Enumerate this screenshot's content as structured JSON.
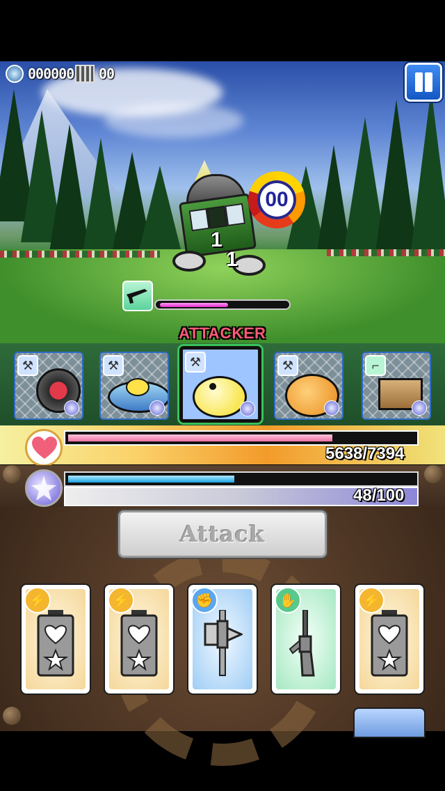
{
  "hud": {
    "currency_icon": "coin-icon",
    "currency_value": "000000",
    "film_icon": "film-icon",
    "film_value": "00",
    "pause_icon": "pause-icon"
  },
  "enemy": {
    "name_icon": "streetcar-robot-enemy",
    "turn_timer": "00",
    "damage_numbers": [
      "1",
      "1"
    ],
    "weapon_type_icon": "rifle-icon",
    "hp_fraction": 0.53
  },
  "party": {
    "active_label": "ATTACKER",
    "members": [
      {
        "name": "tire-robot",
        "type_icon": "axe-icon"
      },
      {
        "name": "saucer-robot",
        "type_icon": "axe-icon"
      },
      {
        "name": "chick-robot",
        "type_icon": "axe-icon",
        "selected": true
      },
      {
        "name": "fish-robot",
        "type_icon": "axe-icon"
      },
      {
        "name": "crate-robot",
        "type_icon": "rifle-icon"
      }
    ]
  },
  "player": {
    "hp_text": "5638/7394",
    "hp_fraction": 0.7625,
    "mp_text": "48/100",
    "mp_fraction": 0.48,
    "hp_icon": "heart-icon",
    "mp_icon": "star-orb-icon"
  },
  "actions": {
    "attack_label": "Attack"
  },
  "hand": [
    {
      "badge": "lightning-icon",
      "art": "battery-heart-card",
      "color": "#f4b52f"
    },
    {
      "badge": "lightning-icon",
      "art": "battery-heart-card",
      "color": "#f4b52f"
    },
    {
      "badge": "fist-icon",
      "art": "hammer-card",
      "color": "#5aa7f0"
    },
    {
      "badge": "hand-icon",
      "art": "rifle-card",
      "color": "#57c98a"
    },
    {
      "badge": "lightning-icon",
      "art": "battery-heart-card",
      "color": "#f4b52f"
    }
  ]
}
